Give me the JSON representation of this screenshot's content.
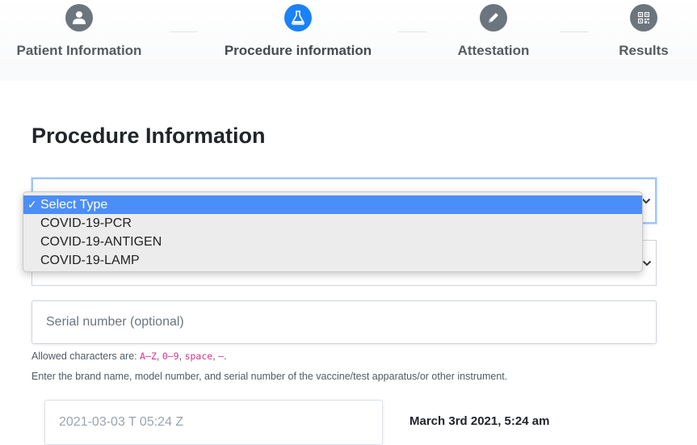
{
  "stepper": {
    "steps": [
      {
        "label": "Patient Information",
        "icon": "user-icon",
        "active": false
      },
      {
        "label": "Procedure information",
        "icon": "flask-icon",
        "active": true
      },
      {
        "label": "Attestation",
        "icon": "pencil-icon",
        "active": false
      },
      {
        "label": "Results",
        "icon": "qr-code-icon",
        "active": false
      }
    ]
  },
  "colors": {
    "active_step": "#1a82f7",
    "inactive_step": "#6c757d",
    "selected_option": "#4c8ef7",
    "code_text": "#d63384"
  },
  "main": {
    "title": "Procedure Information",
    "type_select": {
      "open": true,
      "selected_index": 0,
      "options": [
        "Select Type",
        "COVID-19-PCR",
        "COVID-19-ANTIGEN",
        "COVID-19-LAMP"
      ]
    },
    "second_select": {
      "value": ""
    },
    "serial_input": {
      "placeholder": "Serial number (optional)",
      "value": ""
    },
    "allowed": {
      "prefix": "Allowed characters are: ",
      "codes": [
        "A–Z",
        "0–9",
        "space",
        "–"
      ],
      "separator": ", ",
      "suffix": "."
    },
    "brand_help": "Enter the brand name, model number, and serial number of the vaccine/test apparatus/or other instrument.",
    "datetime": {
      "input_value": "2021-03-03 T 05:24 Z",
      "display": "March 3rd 2021, 5:24 am"
    }
  }
}
